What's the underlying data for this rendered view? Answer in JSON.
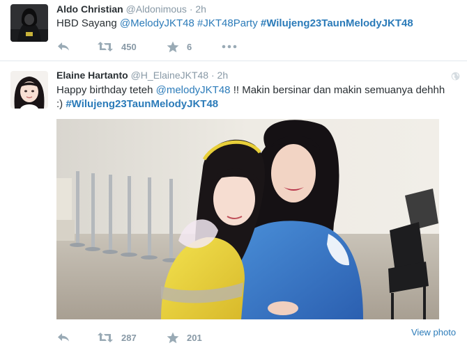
{
  "tweets": [
    {
      "fullname": "Aldo Christian",
      "username": "@Aldonimous",
      "separator": "·",
      "time": "2h",
      "text_parts": [
        {
          "text": "HBD Sayang ",
          "kind": "plain"
        },
        {
          "text": "@MelodyJKT48",
          "kind": "mention"
        },
        {
          "text": " ",
          "kind": "plain"
        },
        {
          "text": "#JKT48Party",
          "kind": "link"
        },
        {
          "text": " ",
          "kind": "plain"
        },
        {
          "text": "#Wilujeng23TaunMelodyJKT48",
          "kind": "hashtag"
        }
      ],
      "retweet_count": "450",
      "favorite_count": "6",
      "more_label": "•••"
    },
    {
      "fullname": "Elaine Hartanto",
      "username": "@H_ElaineJKT48",
      "separator": "·",
      "time": "2h",
      "text_parts": [
        {
          "text": "Happy birthday teteh ",
          "kind": "plain"
        },
        {
          "text": "@melodyJKT48",
          "kind": "mention"
        },
        {
          "text": " !! Makin bersinar dan makin semuanya dehhh :) ",
          "kind": "plain"
        },
        {
          "text": "#Wilujeng23TaunMelodyJKT48",
          "kind": "hashtag"
        }
      ],
      "retweet_count": "287",
      "favorite_count": "201",
      "view_photo_label": "View photo"
    }
  ],
  "icons": {
    "reply": "reply-icon",
    "retweet": "retweet-icon",
    "favorite": "star-icon",
    "more": "more-icon",
    "globe": "globe-icon"
  },
  "colors": {
    "link": "#2b7bb9",
    "muted": "#8899a6",
    "text": "#292f33",
    "divider": "#e1e8ed"
  }
}
